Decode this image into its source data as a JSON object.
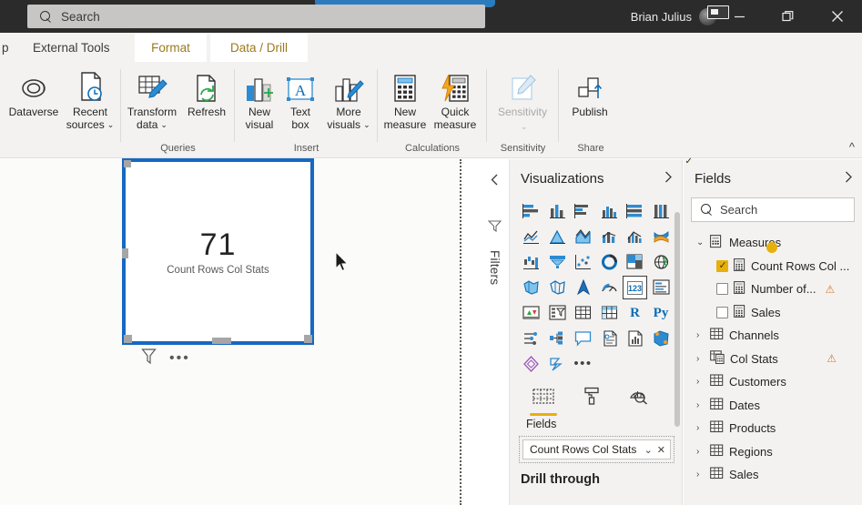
{
  "titlebar": {
    "search_placeholder": "Search",
    "search_icon": "search-icon",
    "user_name": "Brian Julius",
    "minimize_label": "—",
    "restore_label": "❐",
    "close_label": "✕"
  },
  "tabs": [
    {
      "label": "p",
      "state": "partial"
    },
    {
      "label": "External Tools",
      "state": "normal"
    },
    {
      "label": "Format",
      "state": "active"
    },
    {
      "label": "Data / Drill",
      "state": "active"
    }
  ],
  "ribbon": {
    "collapse_label": "^",
    "groups": [
      {
        "name": "data-sources-group",
        "label": "",
        "buttons": [
          {
            "label": "Dataverse",
            "icon": "dataverse-icon",
            "dropdown": false,
            "disabled": false
          },
          {
            "label": "Recent\nsources",
            "label_line1": "Recent",
            "label_line2": "sources",
            "icon": "recent-sources-icon",
            "dropdown": true,
            "disabled": false
          }
        ]
      },
      {
        "name": "queries-group",
        "label": "Queries",
        "buttons": [
          {
            "label_line1": "Transform",
            "label_line2": "data",
            "icon": "transform-data-icon",
            "dropdown": true,
            "disabled": false
          },
          {
            "label_line1": "Refresh",
            "label_line2": "",
            "icon": "refresh-icon",
            "dropdown": false,
            "disabled": false
          }
        ]
      },
      {
        "name": "insert-group",
        "label": "Insert",
        "buttons": [
          {
            "label_line1": "New",
            "label_line2": "visual",
            "icon": "new-visual-icon",
            "dropdown": false,
            "disabled": false
          },
          {
            "label_line1": "Text",
            "label_line2": "box",
            "icon": "text-box-icon",
            "dropdown": false,
            "disabled": false
          },
          {
            "label_line1": "More",
            "label_line2": "visuals",
            "icon": "more-visuals-icon",
            "dropdown": true,
            "disabled": false
          }
        ]
      },
      {
        "name": "calculations-group",
        "label": "Calculations",
        "buttons": [
          {
            "label_line1": "New",
            "label_line2": "measure",
            "icon": "new-measure-icon",
            "dropdown": false,
            "disabled": false
          },
          {
            "label_line1": "Quick",
            "label_line2": "measure",
            "icon": "quick-measure-icon",
            "dropdown": false,
            "disabled": false
          }
        ]
      },
      {
        "name": "sensitivity-group",
        "label": "Sensitivity",
        "buttons": [
          {
            "label_line1": "Sensitivity",
            "label_line2": "",
            "icon": "sensitivity-icon",
            "dropdown": true,
            "disabled": true
          }
        ]
      },
      {
        "name": "share-group",
        "label": "Share",
        "buttons": [
          {
            "label_line1": "Publish",
            "label_line2": "",
            "icon": "publish-icon",
            "dropdown": false,
            "disabled": false
          }
        ]
      }
    ]
  },
  "canvas": {
    "card_visual": {
      "value": "71",
      "label": "Count Rows Col Stats",
      "selected": true,
      "footer_icons": [
        "filter-icon",
        "more-options-icon"
      ]
    },
    "cursor": "mouse-pointer"
  },
  "filters_rail": {
    "collapse_icon": "chevron-left-icon",
    "filter_icon": "filter-icon",
    "label": "Filters"
  },
  "visualizations": {
    "title": "Visualizations",
    "expand_icon": "chevron-right-icon",
    "collapse_icon": "chevron-left-icon",
    "icons": [
      "stacked-bar-chart-icon",
      "stacked-column-chart-icon",
      "clustered-bar-chart-icon",
      "clustered-column-chart-icon",
      "100-stacked-bar-chart-icon",
      "100-stacked-column-chart-icon",
      "line-chart-icon",
      "area-chart-icon",
      "stacked-area-chart-icon",
      "line-and-stacked-column-chart-icon",
      "line-and-clustered-column-chart-icon",
      "ribbon-chart-icon",
      "waterfall-chart-icon",
      "funnel-chart-icon",
      "scatter-chart-icon",
      "pie-chart-icon",
      "treemap-icon",
      "map-icon",
      "filled-map-icon",
      "shape-map-icon",
      "azure-map-icon",
      "gauge-icon",
      "card-icon",
      "multi-row-card-icon",
      "kpi-icon",
      "slicer-icon",
      "table-icon",
      "matrix-icon",
      "r-script-visual-icon",
      "python-visual-icon",
      "key-influencers-icon",
      "decomposition-tree-icon",
      "qa-visual-icon",
      "smart-narrative-icon",
      "paginated-report-icon",
      "arcgis-maps-icon",
      "power-apps-icon",
      "power-automate-icon",
      "more-visuals-ellipsis-icon"
    ],
    "selected_icon_index": 22,
    "selected_icon_text": "123",
    "well_tabs": [
      {
        "label": "Fields",
        "icon": "fields-icon",
        "active": true
      },
      {
        "label": "Format",
        "icon": "paint-roller-icon",
        "active": false
      },
      {
        "label": "Analytics",
        "icon": "analytics-magnifier-icon",
        "active": false
      }
    ],
    "well_section_label": "Fields",
    "well_chip": {
      "name": "Count Rows Col Stats",
      "dropdown_icon": "chevron-down-icon",
      "remove_icon": "close-icon"
    },
    "drill_through_label": "Drill through"
  },
  "fields": {
    "title": "Fields",
    "expand_icon": "chevron-right-icon",
    "search_placeholder": "Search",
    "search_icon": "search-icon",
    "tree": [
      {
        "name": "Measures",
        "type": "folder",
        "expanded": true,
        "level": 0,
        "checked": true,
        "badge": true,
        "warning": false
      },
      {
        "name": "Count Rows Col ...",
        "type": "measure",
        "level": 1,
        "checked": true,
        "warning": false
      },
      {
        "name": "Number of...",
        "type": "measure",
        "level": 1,
        "checked": false,
        "warning": true
      },
      {
        "name": "Sales",
        "type": "measure",
        "level": 1,
        "checked": false,
        "warning": false
      },
      {
        "name": "Channels",
        "type": "table",
        "expanded": false,
        "level": 0,
        "warning": false
      },
      {
        "name": "Col Stats",
        "type": "table-measure",
        "expanded": false,
        "level": 0,
        "warning": true
      },
      {
        "name": "Customers",
        "type": "table",
        "expanded": false,
        "level": 0,
        "warning": false
      },
      {
        "name": "Dates",
        "type": "table",
        "expanded": false,
        "level": 0,
        "warning": false
      },
      {
        "name": "Products",
        "type": "table",
        "expanded": false,
        "level": 0,
        "warning": false
      },
      {
        "name": "Regions",
        "type": "table",
        "expanded": false,
        "level": 0,
        "warning": false
      },
      {
        "name": "Sales",
        "type": "table",
        "expanded": false,
        "level": 0,
        "warning": false
      }
    ]
  },
  "colors": {
    "titlebar_bg": "#2b2b2b",
    "ribbon_bg": "#f3f2f1",
    "accent_blue": "#1668c1",
    "accent_gold": "#e8b00b",
    "tab_active_text": "#9b7a1d",
    "warning_orange": "#d87b29",
    "viz_icon_blue": "#2e8bd0",
    "tooltip_blue": "#2a7cbe"
  }
}
